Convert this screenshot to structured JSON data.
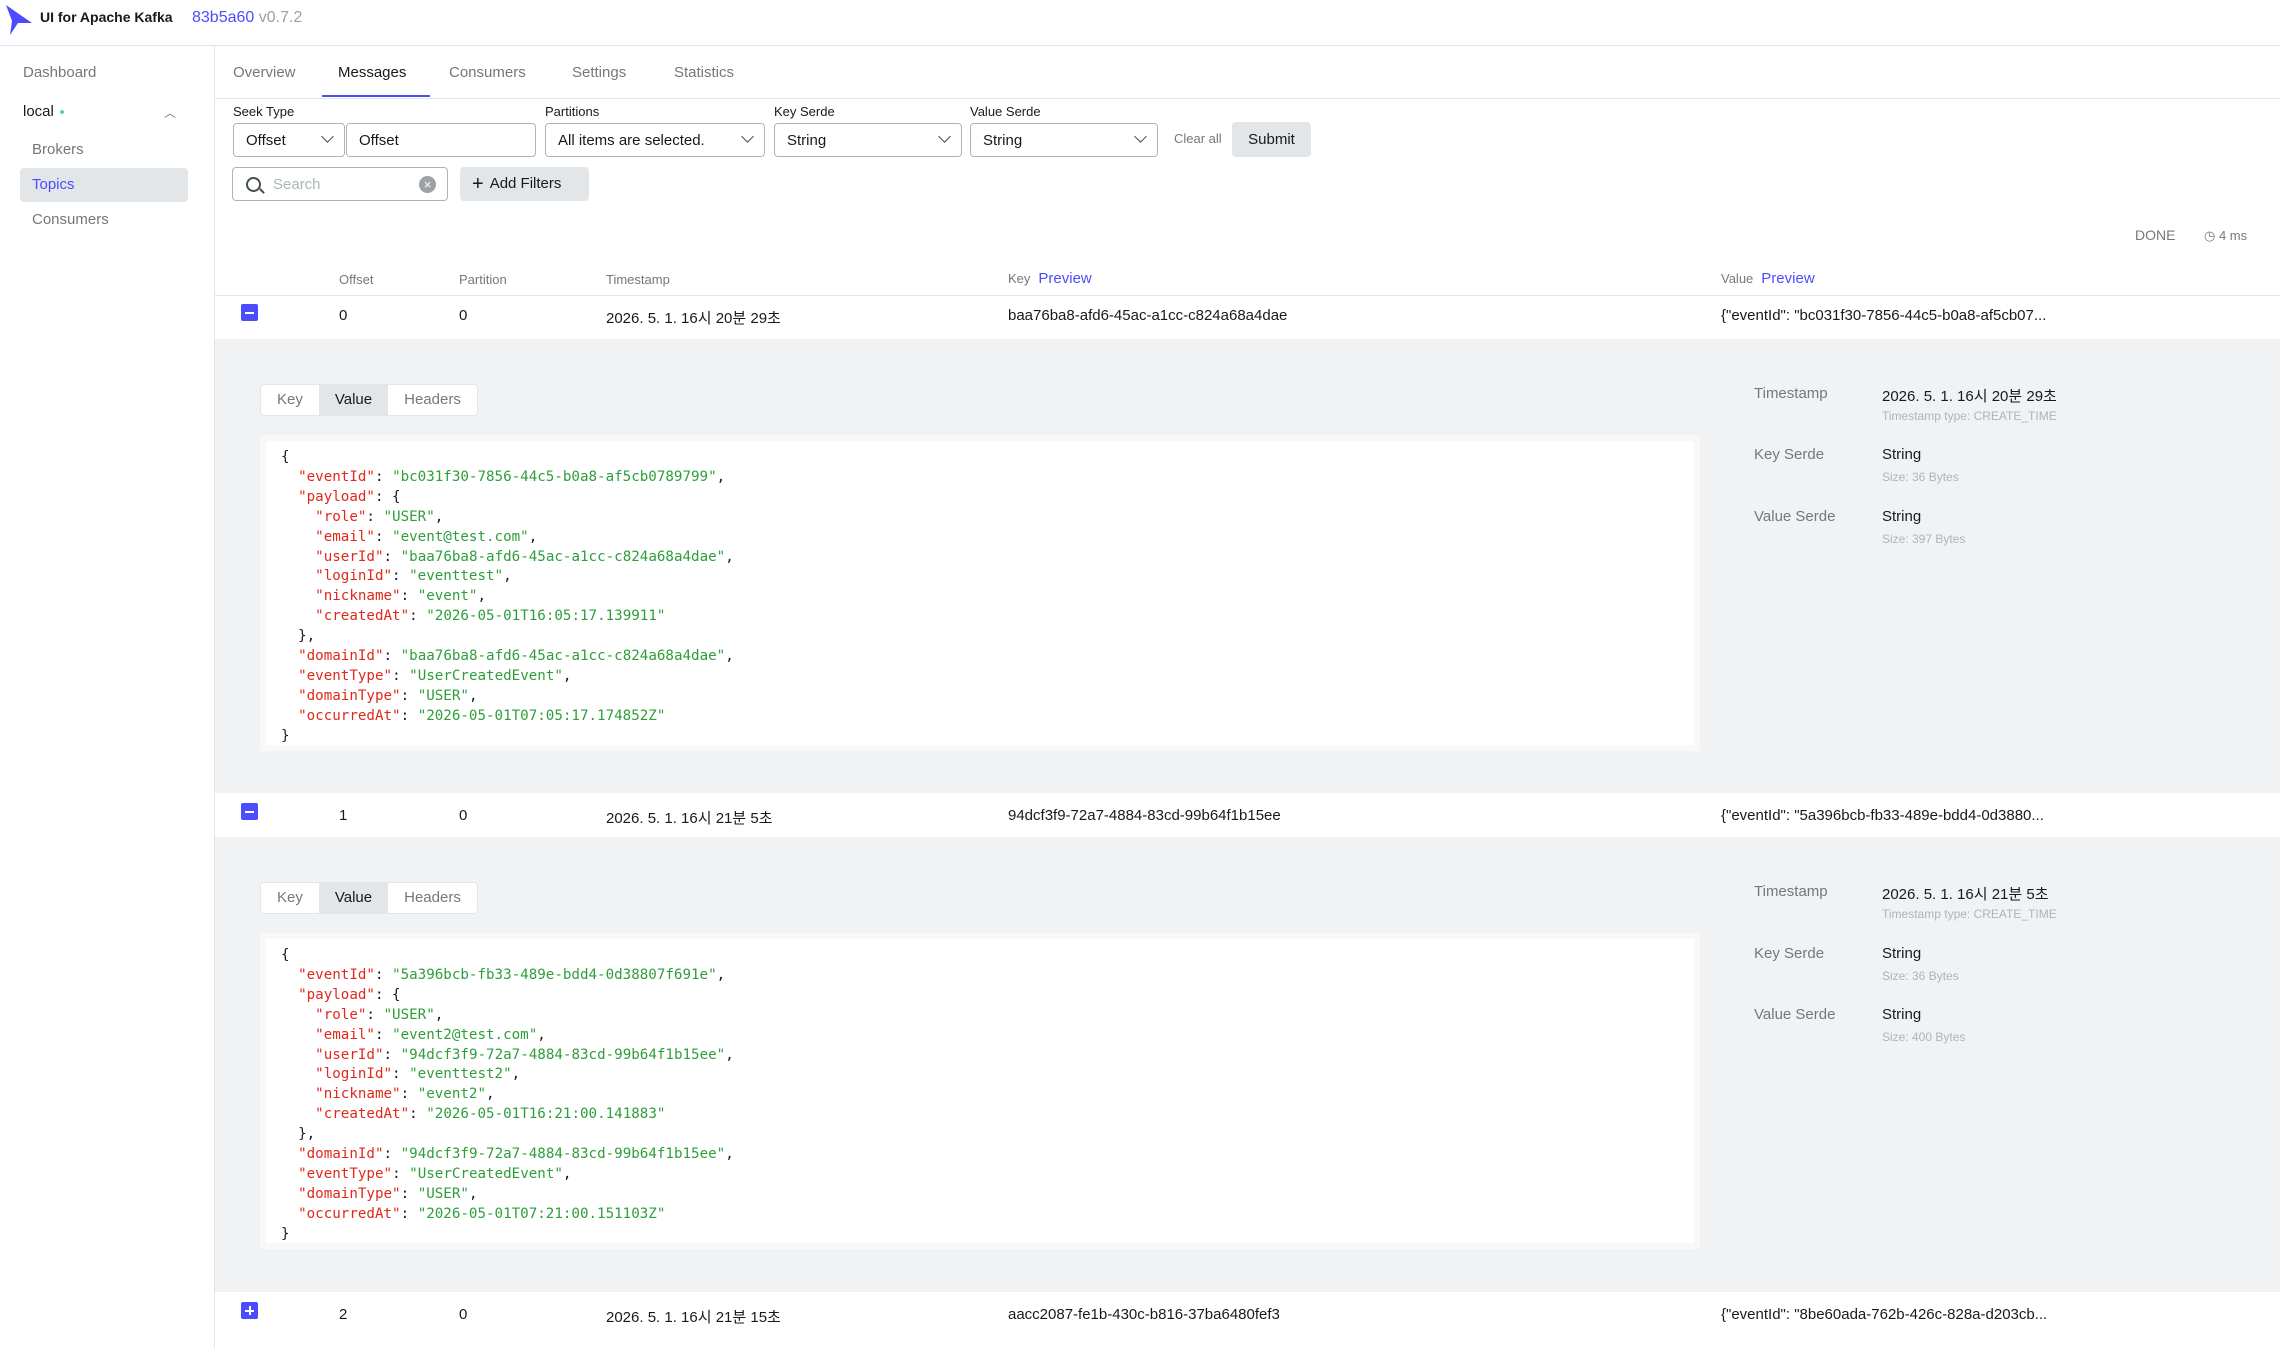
{
  "app": {
    "title": "UI for Apache Kafka",
    "commit": "83b5a60",
    "version": "v0.7.2"
  },
  "sidebar": {
    "dashboard": "Dashboard",
    "cluster": "local",
    "items": [
      {
        "label": "Brokers"
      },
      {
        "label": "Topics"
      },
      {
        "label": "Consumers"
      }
    ]
  },
  "tabs": [
    {
      "label": "Overview"
    },
    {
      "label": "Messages"
    },
    {
      "label": "Consumers"
    },
    {
      "label": "Settings"
    },
    {
      "label": "Statistics"
    }
  ],
  "filters": {
    "seek_type": {
      "label": "Seek Type",
      "value": "Offset"
    },
    "offset_input": {
      "value": "Offset"
    },
    "partitions": {
      "label": "Partitions",
      "value": "All items are selected."
    },
    "key_serde": {
      "label": "Key Serde",
      "value": "String"
    },
    "value_serde": {
      "label": "Value Serde",
      "value": "String"
    },
    "clear_all": "Clear all",
    "submit": "Submit",
    "search_placeholder": "Search",
    "add_filters": "Add Filters"
  },
  "status": {
    "state": "DONE",
    "elapsed": "4 ms"
  },
  "table": {
    "headers": {
      "offset": "Offset",
      "partition": "Partition",
      "timestamp": "Timestamp",
      "key": "Key",
      "value": "Value",
      "preview": "Preview"
    },
    "rows": [
      {
        "offset": "0",
        "partition": "0",
        "timestamp": "2026. 5. 1. 16시 20분 29초",
        "key": "baa76ba8-afd6-45ac-a1cc-c824a68a4dae",
        "value": "{\"eventId\": \"bc031f30-7856-44c5-b0a8-af5cb07...",
        "expanded": true
      },
      {
        "offset": "1",
        "partition": "0",
        "timestamp": "2026. 5. 1. 16시 21분 5초",
        "key": "94dcf3f9-72a7-4884-83cd-99b64f1b15ee",
        "value": "{\"eventId\": \"5a396bcb-fb33-489e-bdd4-0d3880...",
        "expanded": true
      },
      {
        "offset": "2",
        "partition": "0",
        "timestamp": "2026. 5. 1. 16시 21분 15초",
        "key": "aacc2087-fe1b-430c-b816-37ba6480fef3",
        "value": "{\"eventId\": \"8be60ada-762b-426c-828a-d203cb...",
        "expanded": false
      }
    ]
  },
  "details": {
    "subtabs": [
      {
        "label": "Key"
      },
      {
        "label": "Value"
      },
      {
        "label": "Headers"
      }
    ],
    "labels": {
      "timestamp": "Timestamp",
      "key_serde": "Key Serde",
      "value_serde": "Value Serde"
    },
    "messages": [
      {
        "timestamp": "2026. 5. 1. 16시 20분 29초",
        "timestamp_type": "Timestamp type: CREATE_TIME",
        "key_serde": "String",
        "key_size": "Size: 36 Bytes",
        "value_serde": "String",
        "value_size": "Size: 397 Bytes",
        "json": {
          "eventId": "bc031f30-7856-44c5-b0a8-af5cb0789799",
          "payload": {
            "role": "USER",
            "email": "event@test.com",
            "userId": "baa76ba8-afd6-45ac-a1cc-c824a68a4dae",
            "loginId": "eventtest",
            "nickname": "event",
            "createdAt": "2026-05-01T16:05:17.139911"
          },
          "domainId": "baa76ba8-afd6-45ac-a1cc-c824a68a4dae",
          "eventType": "UserCreatedEvent",
          "domainType": "USER",
          "occurredAt": "2026-05-01T07:05:17.174852Z"
        }
      },
      {
        "timestamp": "2026. 5. 1. 16시 21분 5초",
        "timestamp_type": "Timestamp type: CREATE_TIME",
        "key_serde": "String",
        "key_size": "Size: 36 Bytes",
        "value_serde": "String",
        "value_size": "Size: 400 Bytes",
        "json": {
          "eventId": "5a396bcb-fb33-489e-bdd4-0d38807f691e",
          "payload": {
            "role": "USER",
            "email": "event2@test.com",
            "userId": "94dcf3f9-72a7-4884-83cd-99b64f1b15ee",
            "loginId": "eventtest2",
            "nickname": "event2",
            "createdAt": "2026-05-01T16:21:00.141883"
          },
          "domainId": "94dcf3f9-72a7-4884-83cd-99b64f1b15ee",
          "eventType": "UserCreatedEvent",
          "domainType": "USER",
          "occurredAt": "2026-05-01T07:21:00.151103Z"
        }
      }
    ]
  },
  "colors": {
    "accent": "#4c4cff",
    "json_key": "#e0281b",
    "json_string": "#2e9e3a",
    "connected": "#5cd685"
  }
}
